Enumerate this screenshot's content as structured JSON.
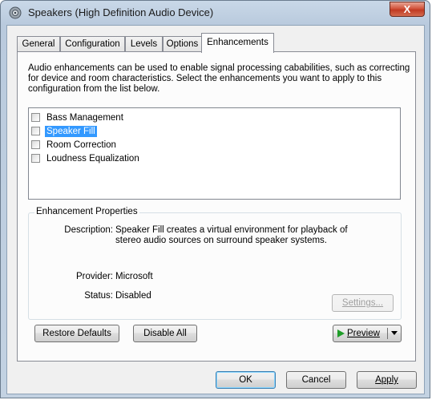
{
  "window": {
    "title": "Speakers (High Definition Audio Device)",
    "close_label": "X"
  },
  "tabs": [
    {
      "label": "General"
    },
    {
      "label": "Configuration"
    },
    {
      "label": "Levels"
    },
    {
      "label": "Options"
    },
    {
      "label": "Enhancements",
      "active": true
    }
  ],
  "intro": "Audio enhancements can be used to enable signal processing cababilities, such as correcting for device and room characteristics. Select the enhancements you want to apply to this configuration from the list below.",
  "enhancements": [
    {
      "label": "Bass Management",
      "checked": false,
      "selected": false
    },
    {
      "label": "Speaker Fill",
      "checked": false,
      "selected": true
    },
    {
      "label": "Room Correction",
      "checked": false,
      "selected": false
    },
    {
      "label": "Loudness Equalization",
      "checked": false,
      "selected": false
    }
  ],
  "properties": {
    "group_title": "Enhancement Properties",
    "description_label": "Description:",
    "description_value": "Speaker Fill creates a virtual environment for playback of stereo audio sources on surround speaker systems.",
    "provider_label": "Provider:",
    "provider_value": "Microsoft",
    "status_label": "Status:",
    "status_value": "Disabled",
    "settings_button": "Settings..."
  },
  "buttons": {
    "restore_defaults": "Restore Defaults",
    "disable_all": "Disable All",
    "preview": "Preview",
    "ok": "OK",
    "cancel": "Cancel",
    "apply": "Apply"
  }
}
